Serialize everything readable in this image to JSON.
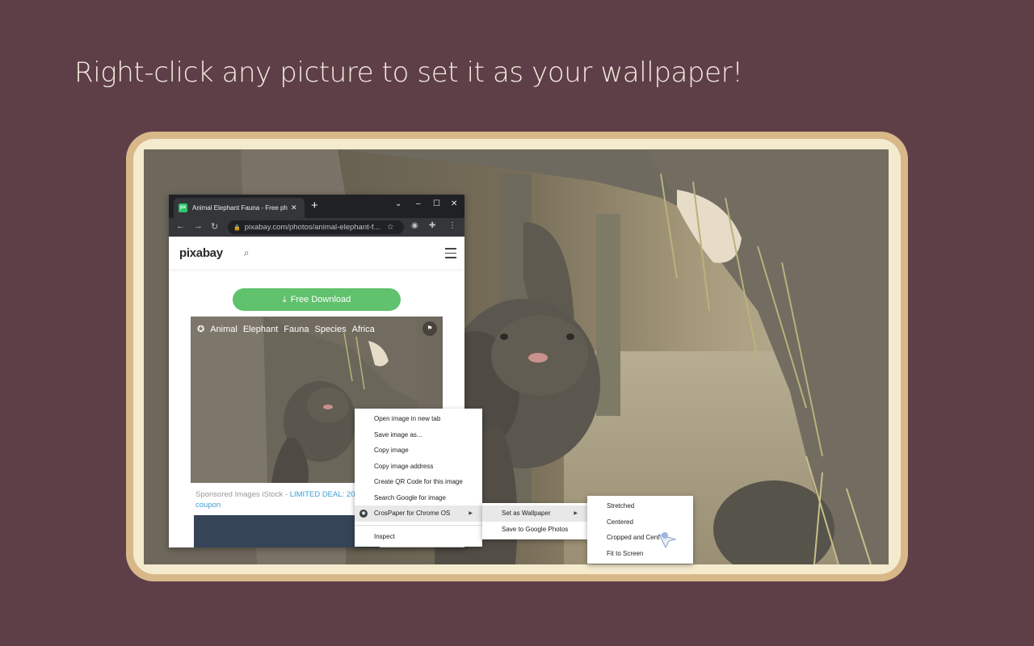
{
  "headline": "Right-click any picture to set it as your wallpaper!",
  "browser": {
    "tab_title": "Animal Elephant Fauna - Free ph",
    "favicon_label": "px",
    "url": "pixabay.com/photos/animal-elephant-f...",
    "site": {
      "logo": "pixabay",
      "download_label": "Free Download",
      "tags": [
        "Animal",
        "Elephant",
        "Fauna",
        "Species",
        "Africa"
      ],
      "sponsored_prefix": "Sponsored Images iStock - ",
      "sponsored_deal": "LIMITED DEAL: 20",
      "sponsored_suffix": "coupon"
    }
  },
  "context_menu": {
    "items": [
      "Open image in new tab",
      "Save image as...",
      "Copy image",
      "Copy image address",
      "Create QR Code for this image",
      "Search Google for image",
      "CrosPaper for Chrome OS",
      "Inspect"
    ]
  },
  "submenu": {
    "items": [
      "Set as Wallpaper",
      "Save to Google Photos"
    ]
  },
  "wallpaper_menu": {
    "items": [
      "Stretched",
      "Centered",
      "Cropped and Cent",
      "Fit to Screen"
    ]
  },
  "colors": {
    "background": "#5e3f48",
    "frame_outer": "#d8b889",
    "frame_inner": "#f4ebcf",
    "download_button": "#60c26c",
    "headline": "#f3ebdd"
  }
}
